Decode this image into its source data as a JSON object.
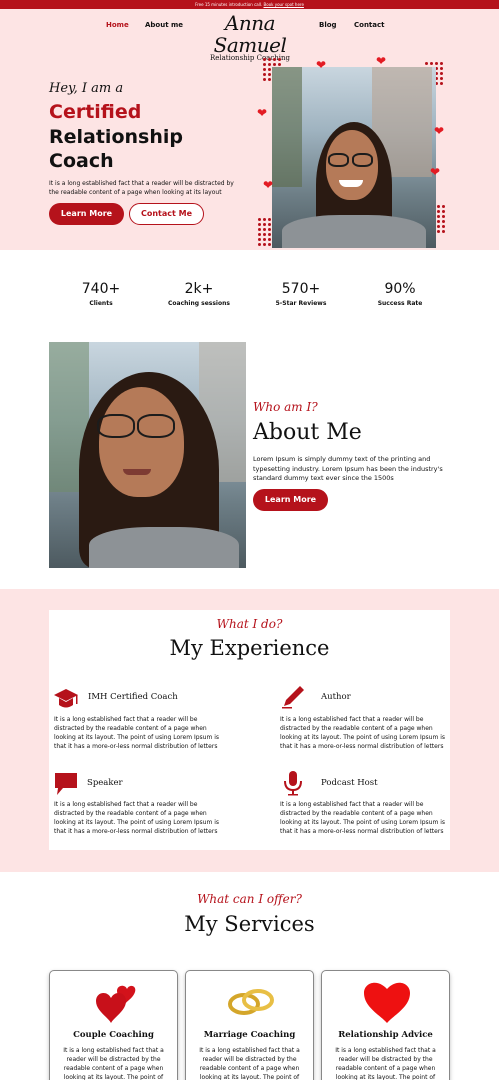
{
  "topbar": {
    "text": "Free 15 minutes introduction call.",
    "link": "Book your spot here"
  },
  "nav": {
    "links": [
      "Home",
      "About me",
      "Blog",
      "Contact"
    ],
    "logo_name": "Anna Samuel",
    "logo_sub": "Relationship Coaching"
  },
  "hero": {
    "greeting": "Hey, I am a",
    "title_red": "Certified",
    "title_line2": "Relationship",
    "title_line3": "Coach",
    "paragraph": "It is a long established fact that a reader will be distracted by the readable content of a page when looking at its layout",
    "btn_primary": "Learn More",
    "btn_secondary": "Contact Me"
  },
  "stats": [
    {
      "value": "740+",
      "label": "Clients"
    },
    {
      "value": "2k+",
      "label": "Coaching sessions"
    },
    {
      "value": "570+",
      "label": "5-Star Reviews"
    },
    {
      "value": "90%",
      "label": "Success Rate"
    }
  ],
  "about": {
    "eyebrow": "Who am I?",
    "heading": "About Me",
    "paragraph": "Lorem Ipsum is simply dummy text of the printing and typesetting industry. Lorem Ipsum has been the industry's standard dummy text ever since the 1500s",
    "button": "Learn More"
  },
  "experience": {
    "eyebrow": "What I do?",
    "heading": "My Experience",
    "items": [
      {
        "icon": "graduation-cap-icon",
        "title": "IMH Certified Coach",
        "text": "It is a long established fact that a reader will be distracted by the readable content of a page when looking at its layout. The point of using Lorem Ipsum is that it has a more-or-less normal distribution of letters"
      },
      {
        "icon": "pen-icon",
        "title": "Author",
        "text": "It is a long established fact that a reader will be distracted by the readable content of a page when looking at its layout. The point of using Lorem Ipsum is that it has a more-or-less normal distribution of letters"
      },
      {
        "icon": "speech-bubble-icon",
        "title": "Speaker",
        "text": "It is a long established fact that a reader will be distracted by the readable content of a page when looking at its layout. The point of using Lorem Ipsum is that it has a more-or-less normal distribution of letters"
      },
      {
        "icon": "microphone-icon",
        "title": "Podcast Host",
        "text": "It is a long established fact that a reader will be distracted by the readable content of a page when looking at its layout. The point of using Lorem Ipsum is that it has a more-or-less normal distribution of letters"
      }
    ]
  },
  "services": {
    "eyebrow": "What can I offer?",
    "heading": "My Services",
    "items": [
      {
        "icon": "two-hearts-icon",
        "title": "Couple Coaching",
        "text": "It is a long established fact that a reader will be distracted by the readable content of a page when looking at its layout. The point of using Lorem Ipsum is"
      },
      {
        "icon": "wedding-rings-icon",
        "title": "Marriage Coaching",
        "text": "It is a long established fact that a reader will be distracted by the readable content of a page when looking at its layout. The point of using Lorem Ipsum is"
      },
      {
        "icon": "heart-icon",
        "title": "Relationship Advice",
        "text": "It is a long established fact that a reader will be distracted by the readable content of a page when looking at its layout. The point of using Lorem Ipsum is"
      }
    ]
  },
  "colors": {
    "accent": "#b5121b",
    "hero_bg": "#fde4e4",
    "heart": "#e31b23"
  }
}
